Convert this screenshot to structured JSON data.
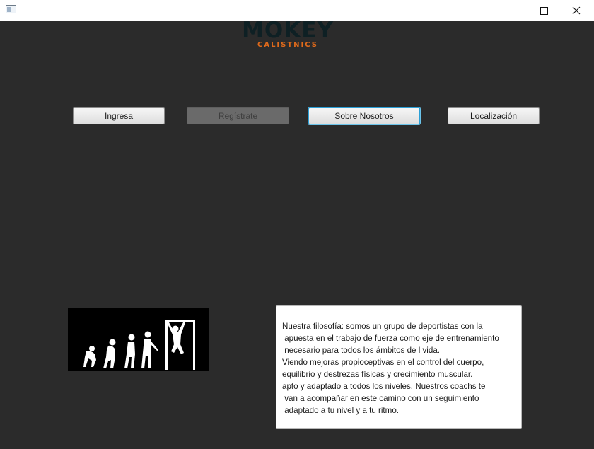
{
  "window": {
    "title": ""
  },
  "logo": {
    "main": "MOKEY",
    "sub": "CALISTNICS"
  },
  "nav": {
    "ingresa": "Ingresa",
    "registrate": "Regístrate",
    "sobre_nosotros": "Sobre Nosotros",
    "localizacion": "Localización"
  },
  "image": {
    "subject": "evolution-to-calisthenics-silhouette"
  },
  "about": {
    "lines": [
      "Nuestra filosofía: somos un grupo de deportistas con la",
      " apuesta en el trabajo de fuerza como eje de entrenamiento",
      " necesario para todos los ámbitos de l vida.",
      "Viendo mejoras propioceptivas en el control del cuerpo,",
      "equilibrio y destrezas físicas y crecimiento muscular.",
      "apto y adaptado a todos los niveles. Nuestros coachs te",
      " van a acompañar en este camino con un seguimiento",
      " adaptado a tu nivel y a tu ritmo."
    ]
  },
  "colors": {
    "background": "#2b2b2b",
    "logo_dark": "#0e2024",
    "logo_accent": "#e06a1b",
    "focus": "#2a9fd6"
  }
}
